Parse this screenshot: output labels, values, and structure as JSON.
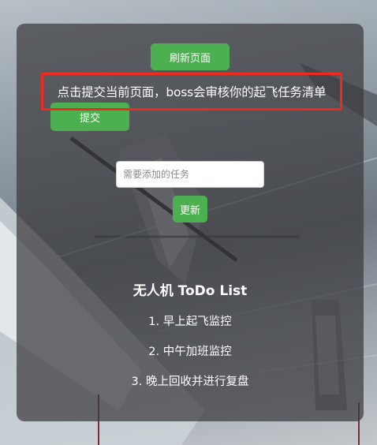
{
  "toolbar": {
    "refresh_label": "刷新页面",
    "submit_label": "提交"
  },
  "notice": {
    "text": "点击提交当前页面，boss会审核你的起飞任务清单"
  },
  "task_form": {
    "input_placeholder": "需要添加的任务",
    "input_value": "",
    "update_label": "更新"
  },
  "todo": {
    "title": "无人机 ToDo List",
    "items": [
      {
        "label": "1. 早上起飞监控"
      },
      {
        "label": "2. 中午加班监控"
      },
      {
        "label": "3. 晚上回收并进行复盘"
      }
    ]
  },
  "colors": {
    "button_green": "#4caf50",
    "highlight_red": "#f02b1d",
    "card_overlay": "rgba(58,58,62,0.72)"
  }
}
